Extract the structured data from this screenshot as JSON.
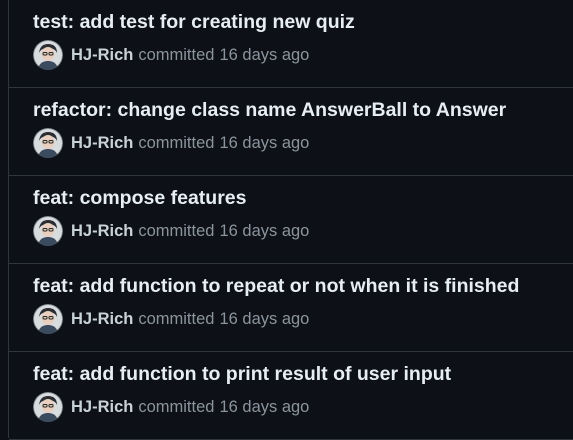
{
  "commits": [
    {
      "title": "test: add test for creating new quiz",
      "author": "HJ-Rich",
      "verb": "committed",
      "time": "16 days ago"
    },
    {
      "title": "refactor: change class name AnswerBall to Answer",
      "author": "HJ-Rich",
      "verb": "committed",
      "time": "16 days ago"
    },
    {
      "title": "feat: compose features",
      "author": "HJ-Rich",
      "verb": "committed",
      "time": "16 days ago"
    },
    {
      "title": "feat: add function to repeat or not when it is finished",
      "author": "HJ-Rich",
      "verb": "committed",
      "time": "16 days ago"
    },
    {
      "title": "feat: add function to print result of user input",
      "author": "HJ-Rich",
      "verb": "committed",
      "time": "16 days ago"
    }
  ],
  "colors": {
    "background": "#0d1117",
    "border": "#30363d",
    "title": "#e6edf3",
    "author": "#c9d1d9",
    "muted": "#8b949e"
  },
  "icons": {
    "avatar": "user-avatar-icon"
  }
}
